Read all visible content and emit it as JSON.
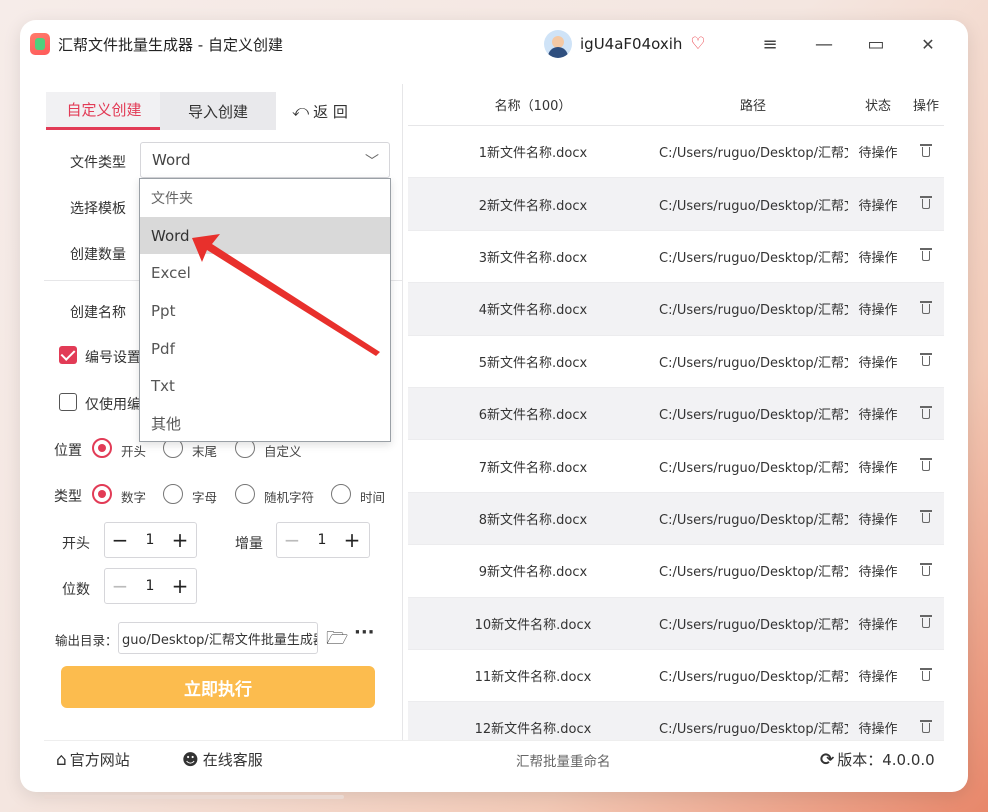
{
  "window": {
    "title": "汇帮文件批量生成器 - 自定义创建",
    "username": "igU4aF04oxih",
    "controls": [
      "≡",
      "—",
      "▭",
      "✕"
    ]
  },
  "left": {
    "tab_custom": "自定义创建",
    "tab_import": "导入创建",
    "back_label": "返 回",
    "file_type_label": "文件类型",
    "file_type_value": "Word",
    "template_label": "选择模板",
    "count_label": "创建数量",
    "name_label": "创建名称",
    "numbering_label": "编号设置",
    "only_use_label": "仅使用编",
    "position_label": "位置",
    "position_options": [
      "开头",
      "末尾",
      "自定义"
    ],
    "type_label": "类型",
    "type_options": [
      "数字",
      "字母",
      "随机字符",
      "时间"
    ],
    "start_label": "开头",
    "start_value": "1",
    "increment_label": "增量",
    "increment_value": "1",
    "digits_label": "位数",
    "digits_value": "1",
    "output_label": "输出目录：",
    "output_value": "guo/Desktop/汇帮文件批量生成器",
    "execute_label": "立即执行"
  },
  "dropdown": {
    "options": [
      "文件夹",
      "Word",
      "Excel",
      "Ppt",
      "Pdf",
      "Txt",
      "其他"
    ],
    "selected_index": 1
  },
  "table": {
    "headers": [
      "名称（100）",
      "路径",
      "状态",
      "操作"
    ],
    "rows": [
      {
        "name": "1新文件名称.docx",
        "path": "C:/Users/ruguo/Desktop/汇帮文",
        "status": "待操作"
      },
      {
        "name": "2新文件名称.docx",
        "path": "C:/Users/ruguo/Desktop/汇帮文",
        "status": "待操作"
      },
      {
        "name": "3新文件名称.docx",
        "path": "C:/Users/ruguo/Desktop/汇帮文",
        "status": "待操作"
      },
      {
        "name": "4新文件名称.docx",
        "path": "C:/Users/ruguo/Desktop/汇帮文",
        "status": "待操作"
      },
      {
        "name": "5新文件名称.docx",
        "path": "C:/Users/ruguo/Desktop/汇帮文",
        "status": "待操作"
      },
      {
        "name": "6新文件名称.docx",
        "path": "C:/Users/ruguo/Desktop/汇帮文",
        "status": "待操作"
      },
      {
        "name": "7新文件名称.docx",
        "path": "C:/Users/ruguo/Desktop/汇帮文",
        "status": "待操作"
      },
      {
        "name": "8新文件名称.docx",
        "path": "C:/Users/ruguo/Desktop/汇帮文",
        "status": "待操作"
      },
      {
        "name": "9新文件名称.docx",
        "path": "C:/Users/ruguo/Desktop/汇帮文",
        "status": "待操作"
      },
      {
        "name": "10新文件名称.docx",
        "path": "C:/Users/ruguo/Desktop/汇帮文",
        "status": "待操作"
      },
      {
        "name": "11新文件名称.docx",
        "path": "C:/Users/ruguo/Desktop/汇帮文",
        "status": "待操作"
      },
      {
        "name": "12新文件名称.docx",
        "path": "C:/Users/ruguo/Desktop/汇帮文",
        "status": "待操作"
      }
    ]
  },
  "footer": {
    "website": "官方网站",
    "service": "在线客服",
    "center": "汇帮批量重命名",
    "version": "版本：4.0.0.0"
  },
  "colors": {
    "accent": "#e23b56",
    "execute": "#fcbc4e",
    "arrow": "#e8302c"
  }
}
